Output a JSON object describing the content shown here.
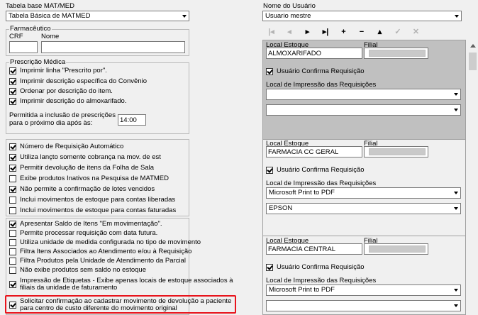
{
  "left": {
    "tabela_label": "Tabela base MAT/MED",
    "tabela_value": "Tabela Básica de MATMED",
    "farmaceutico": {
      "title": "Farmacêutico",
      "crf_label": "CRF",
      "nome_label": "Nome",
      "crf_value": "",
      "nome_value": ""
    },
    "prescricao": {
      "title": "Prescrição Médica",
      "items": [
        {
          "label": "Imprimir linha \"Prescrito por\".",
          "checked": true
        },
        {
          "label": "Imprimir descrição específica do Convênio",
          "checked": true
        },
        {
          "label": "Ordenar por descrição do item.",
          "checked": true
        },
        {
          "label": "Imprimir descrição do almoxarifado.",
          "checked": true
        }
      ],
      "permitida_line1": "Permitida a inclusão de prescrições",
      "permitida_line2": "para o próximo dia após às:",
      "time_value": "14:00"
    },
    "group2": [
      {
        "label": "Número de Requisição Automático",
        "checked": true
      },
      {
        "label": "Utiliza lançto somente cobrança na mov. de est",
        "checked": true
      },
      {
        "label": "Permitir devolução de itens da Folha de Sala",
        "checked": true
      },
      {
        "label": "Exibe produtos Inativos na Pesquisa de MATMED",
        "checked": false
      },
      {
        "label": "Não permite a confirmação de lotes vencidos",
        "checked": true
      },
      {
        "label": "Inclui movimentos de estoque para contas liberadas",
        "checked": false
      },
      {
        "label": "Inclui movimentos de estoque para contas faturadas",
        "checked": false
      }
    ],
    "group3": [
      {
        "label": "Apresentar Saldo de Itens \"Em movimentação\".",
        "checked": true
      },
      {
        "label": "Permite processar requisição com data futura.",
        "checked": false
      },
      {
        "label": "Utiliza unidade de medida configurada no tipo de movimento",
        "checked": false
      },
      {
        "label": "Filtra Itens Associados ao Atendimento e/ou à Requisição",
        "checked": false
      },
      {
        "label": "Filtra Produtos pela Unidade de Atendimento da Parcial",
        "checked": false
      },
      {
        "label": "Não exibe produtos sem saldo no estoque",
        "checked": false
      }
    ],
    "etiquetas": {
      "line1": "Impressão de Etiquetas - Exibe apenas locais de estoque associados à",
      "line2": "filiais da unidade de faturamento",
      "checked": true
    },
    "solicitar": {
      "line1": "Solicitar confirmação ao cadastrar movimento de devolução a paciente",
      "line2": "para centro de custo diferente do movimento original",
      "checked": true
    },
    "highlight_color": "#e8141c"
  },
  "right": {
    "usuario_label": "Nome do Usuário",
    "usuario_value": "Usuario mestre",
    "toolbar": [
      {
        "icon": "first-icon",
        "glyph": "|◂",
        "enabled": false
      },
      {
        "icon": "prior-icon",
        "glyph": "◂",
        "enabled": false
      },
      {
        "icon": "next-icon",
        "glyph": "▸",
        "enabled": true
      },
      {
        "icon": "last-icon",
        "glyph": "▸|",
        "enabled": true
      },
      {
        "icon": "insert-icon",
        "glyph": "+",
        "enabled": true
      },
      {
        "icon": "delete-icon",
        "glyph": "−",
        "enabled": true
      },
      {
        "icon": "edit-icon",
        "glyph": "▴",
        "enabled": true
      },
      {
        "icon": "post-icon",
        "glyph": "✓",
        "enabled": false
      },
      {
        "icon": "cancel-icon",
        "glyph": "✕",
        "enabled": false
      }
    ],
    "blocks": [
      {
        "local_label": "Local Estoque",
        "filial_label": "Filial",
        "local_value": "ALMOXARIFADO",
        "confirma_label": "Usuário Confirma Requisição",
        "confirma_checked": true,
        "impressao_label": "Local de Impressão das Requisições",
        "printer1": "",
        "printer2": ""
      },
      {
        "local_label": "Local Estoque",
        "filial_label": "Filial",
        "local_value": "FARMACIA CC GERAL",
        "confirma_label": "Usuário Confirma Requisição",
        "confirma_checked": true,
        "impressao_label": "Local de Impressão das Requisições",
        "printer1": "Microsoft Print to PDF",
        "printer2": "EPSON"
      },
      {
        "local_label": "Local Estoque",
        "filial_label": "Filial",
        "local_value": "FARMACIA CENTRAL",
        "confirma_label": "Usuário Confirma Requisição",
        "confirma_checked": true,
        "impressao_label": "Local de Impressão das Requisições",
        "printer1": "Microsoft Print to PDF",
        "printer2": ""
      }
    ],
    "active_block_color": "#c0c0c0"
  }
}
